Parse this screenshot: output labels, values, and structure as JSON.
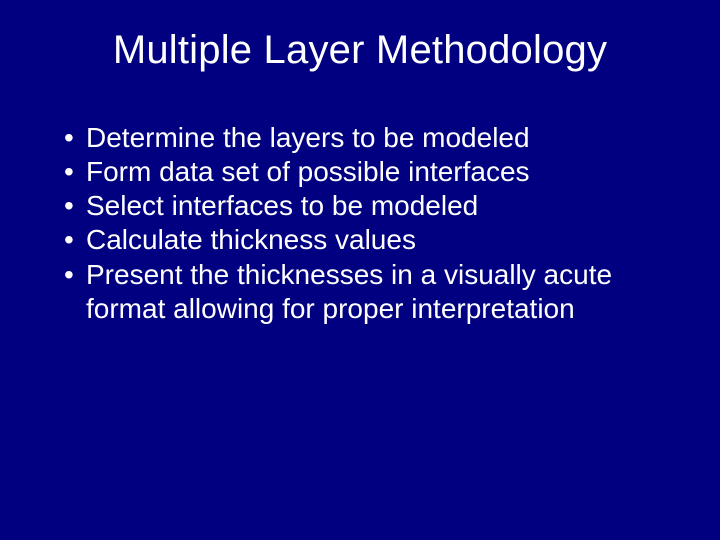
{
  "title": "Multiple Layer Methodology",
  "bullets": [
    "Determine the layers to be modeled",
    "Form data set of possible interfaces",
    "Select interfaces to be modeled",
    "Calculate thickness values",
    "Present the thicknesses in a visually acute format allowing for proper interpretation"
  ]
}
